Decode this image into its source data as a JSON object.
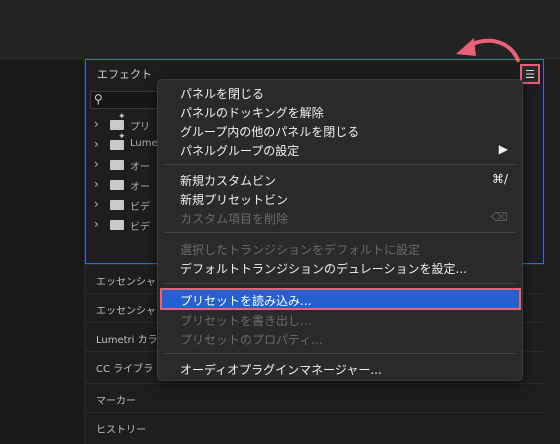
{
  "effects_panel": {
    "title": "エフェクト",
    "menu_icon": "hamburger-menu-icon",
    "tree_items": [
      {
        "label": "プリ",
        "icon": "preset-folder-icon"
      },
      {
        "label": "Lume",
        "icon": "preset-folder-icon"
      },
      {
        "label": "オー",
        "icon": "folder-icon"
      },
      {
        "label": "オー",
        "icon": "folder-icon"
      },
      {
        "label": "ビデ",
        "icon": "folder-icon"
      },
      {
        "label": "ビデ",
        "icon": "folder-icon"
      }
    ]
  },
  "side_panels": [
    "エッセンシャ",
    "エッセンシャ",
    "Lumetri カラ",
    "CC ライブラ",
    "マーカー",
    "ヒストリー"
  ],
  "context_menu": {
    "items": [
      {
        "label": "パネルを閉じる",
        "enabled": true
      },
      {
        "label": "パネルのドッキングを解除",
        "enabled": true
      },
      {
        "label": "グループ内の他のパネルを閉じる",
        "enabled": true
      },
      {
        "label": "パネルグループの設定",
        "enabled": true,
        "submenu_glyph": "▶"
      },
      {
        "label": "新規カスタムビン",
        "enabled": true,
        "shortcut": "⌘/"
      },
      {
        "label": "新規プリセットビン",
        "enabled": true
      },
      {
        "label": "カスタム項目を削除",
        "enabled": false,
        "shortcut": "⌫"
      },
      {
        "label": "選択したトランジションをデフォルトに設定",
        "enabled": false
      },
      {
        "label": "デフォルトトランジションのデュレーションを設定...",
        "enabled": true
      },
      {
        "label": "プリセットを読み込み...",
        "enabled": true,
        "highlighted": true
      },
      {
        "label": "プリセットを書き出し...",
        "enabled": false
      },
      {
        "label": "プリセットのプロパティ...",
        "enabled": false
      },
      {
        "label": "オーディオプラグインマネージャー...",
        "enabled": true
      }
    ]
  },
  "colors": {
    "highlight": "#2461cf",
    "annotation": "#e96079",
    "panel_focus_border": "#2f6fe0"
  }
}
